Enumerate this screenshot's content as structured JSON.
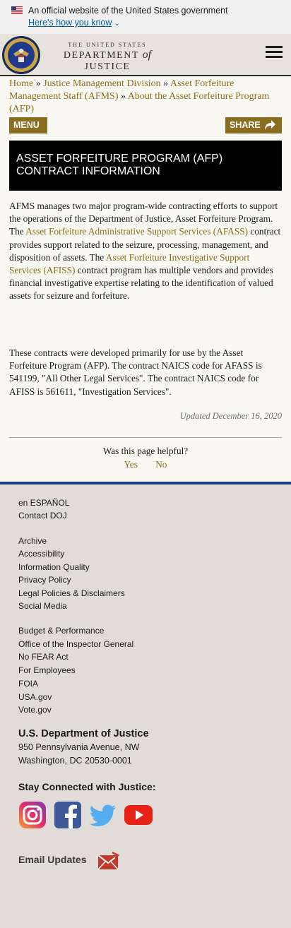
{
  "banner": {
    "text": "An official website of the United States government",
    "link": "Here's how you know"
  },
  "header": {
    "wordmark_top": "THE UNITED STATES",
    "wordmark_department": "DEPARTMENT",
    "wordmark_of": "of",
    "wordmark_justice": "JUSTICE"
  },
  "breadcrumb": {
    "items": [
      "Home",
      "Justice Management Division",
      "Asset Forfeiture Management Staff (AFMS)",
      "About the Asset Forfeiture Program (AFP)"
    ],
    "separator": "»"
  },
  "buttons": {
    "menu": "MENU +",
    "share": "SHARE"
  },
  "page_title": "ASSET FORFEITURE PROGRAM (AFP) CONTRACT INFORMATION",
  "content": {
    "p1_a": "AFMS manages two major program-wide contracting efforts to support the operations of the Department of Justice, Asset Forfeiture Program. The ",
    "p1_link1": "Asset Forfeiture Administrative Support Services (AFASS)",
    "p1_b": " contract provides support related to the seizure, processing, management, and disposition of assets. The ",
    "p1_link2": "Asset Forfeiture Investigative Support Services (AFISS)",
    "p1_c": " contract program has multiple vendors and provides financial investigative expertise relating to the identification of valued assets for seizure and forfeiture.",
    "p2": "These contracts were developed primarily for use by the Asset Forfeiture Program (AFP). The contract NAICS code for AFASS is 541199, \"All Other Legal Services\". The contract NAICS code for AFISS is 561611, \"Investigation Services\".",
    "updated": "Updated December 16, 2020"
  },
  "feedback": {
    "question": "Was this page helpful?",
    "yes": "Yes",
    "no": "No"
  },
  "footer": {
    "group1": [
      "en ESPAÑOL",
      "Contact DOJ"
    ],
    "group2": [
      "Archive",
      "Accessibility",
      "Information Quality",
      "Privacy Policy",
      "Legal Policies & Disclaimers",
      "Social Media"
    ],
    "group3": [
      "Budget & Performance",
      "Office of the Inspector General",
      "No FEAR Act",
      "For Employees",
      "FOIA",
      "USA.gov",
      "Vote.gov"
    ],
    "address_title": "U.S. Department of Justice",
    "address_line1": "950 Pennsylvania Avenue, NW",
    "address_line2": "Washington, DC 20530-0001",
    "stay_connected": "Stay Connected with Justice:",
    "social_icons": [
      "instagram-icon",
      "facebook-icon",
      "twitter-icon",
      "youtube-icon"
    ],
    "email_updates": "Email Updates"
  },
  "colors": {
    "accent_gold": "#8a6d1e",
    "link_blue": "#005ea2",
    "footer_bg": "#e1dcd8",
    "footer_top_border": "#1a4480"
  }
}
